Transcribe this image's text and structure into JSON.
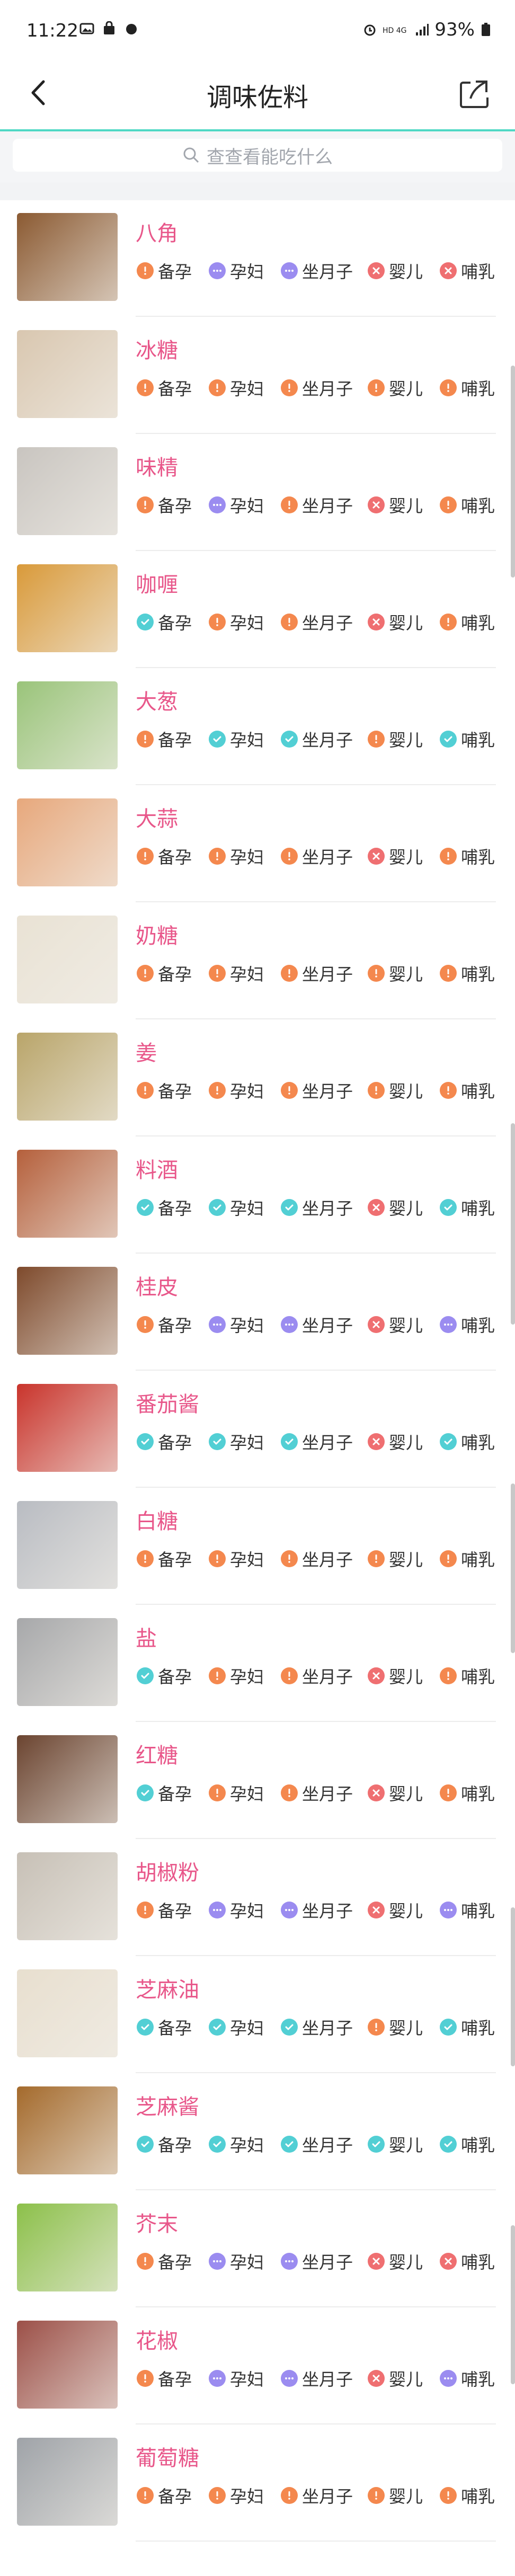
{
  "status": {
    "time": "11:22",
    "battery": "93%"
  },
  "nav": {
    "title": "调味佐料"
  },
  "search": {
    "placeholder": "查查看能吃什么"
  },
  "colors": {
    "accent": "#4fd8c4",
    "name": "#e8578a",
    "warn": "#f4884e",
    "ok": "#52cfd4",
    "mid": "#9b8cf0",
    "no": "#ef6f71"
  },
  "tag_labels": [
    "备孕",
    "孕妇",
    "坐月子",
    "婴儿",
    "哺乳"
  ],
  "items": [
    {
      "name": "八角",
      "status": [
        "warn",
        "mid",
        "mid",
        "no",
        "no"
      ],
      "thumb": "#8b5a32"
    },
    {
      "name": "冰糖",
      "status": [
        "warn",
        "warn",
        "warn",
        "warn",
        "warn"
      ],
      "thumb": "#d9c7b0"
    },
    {
      "name": "味精",
      "status": [
        "warn",
        "mid",
        "warn",
        "no",
        "warn"
      ],
      "thumb": "#c9c5c0"
    },
    {
      "name": "咖喱",
      "status": [
        "ok",
        "warn",
        "warn",
        "no",
        "warn"
      ],
      "thumb": "#d99a3a"
    },
    {
      "name": "大葱",
      "status": [
        "warn",
        "ok",
        "ok",
        "warn",
        "ok"
      ],
      "thumb": "#9ac47a"
    },
    {
      "name": "大蒜",
      "status": [
        "warn",
        "warn",
        "warn",
        "no",
        "warn"
      ],
      "thumb": "#e7a87c"
    },
    {
      "name": "奶糖",
      "status": [
        "warn",
        "warn",
        "warn",
        "warn",
        "warn"
      ],
      "thumb": "#e9e2d4"
    },
    {
      "name": "姜",
      "status": [
        "warn",
        "warn",
        "warn",
        "warn",
        "warn"
      ],
      "thumb": "#b9a56a"
    },
    {
      "name": "料酒",
      "status": [
        "ok",
        "ok",
        "ok",
        "no",
        "ok"
      ],
      "thumb": "#b5603c"
    },
    {
      "name": "桂皮",
      "status": [
        "warn",
        "mid",
        "mid",
        "no",
        "mid"
      ],
      "thumb": "#7e4a2c"
    },
    {
      "name": "番茄酱",
      "status": [
        "ok",
        "ok",
        "ok",
        "no",
        "ok"
      ],
      "thumb": "#c9342c"
    },
    {
      "name": "白糖",
      "status": [
        "warn",
        "warn",
        "warn",
        "warn",
        "warn"
      ],
      "thumb": "#b9bcc2"
    },
    {
      "name": "盐",
      "status": [
        "ok",
        "warn",
        "warn",
        "no",
        "warn"
      ],
      "thumb": "#a7a8aa"
    },
    {
      "name": "红糖",
      "status": [
        "ok",
        "warn",
        "warn",
        "no",
        "warn"
      ],
      "thumb": "#6b4430"
    },
    {
      "name": "胡椒粉",
      "status": [
        "warn",
        "mid",
        "mid",
        "no",
        "mid"
      ],
      "thumb": "#c7c0b6"
    },
    {
      "name": "芝麻油",
      "status": [
        "ok",
        "ok",
        "ok",
        "warn",
        "ok"
      ],
      "thumb": "#e8dfcf"
    },
    {
      "name": "芝麻酱",
      "status": [
        "ok",
        "ok",
        "ok",
        "ok",
        "ok"
      ],
      "thumb": "#a46a2c"
    },
    {
      "name": "芥末",
      "status": [
        "warn",
        "mid",
        "mid",
        "no",
        "no"
      ],
      "thumb": "#8cc04a"
    },
    {
      "name": "花椒",
      "status": [
        "warn",
        "mid",
        "mid",
        "no",
        "mid"
      ],
      "thumb": "#9c5048"
    },
    {
      "name": "葡萄糖",
      "status": [
        "warn",
        "warn",
        "warn",
        "warn",
        "warn"
      ],
      "thumb": "#9fa3a8"
    }
  ]
}
